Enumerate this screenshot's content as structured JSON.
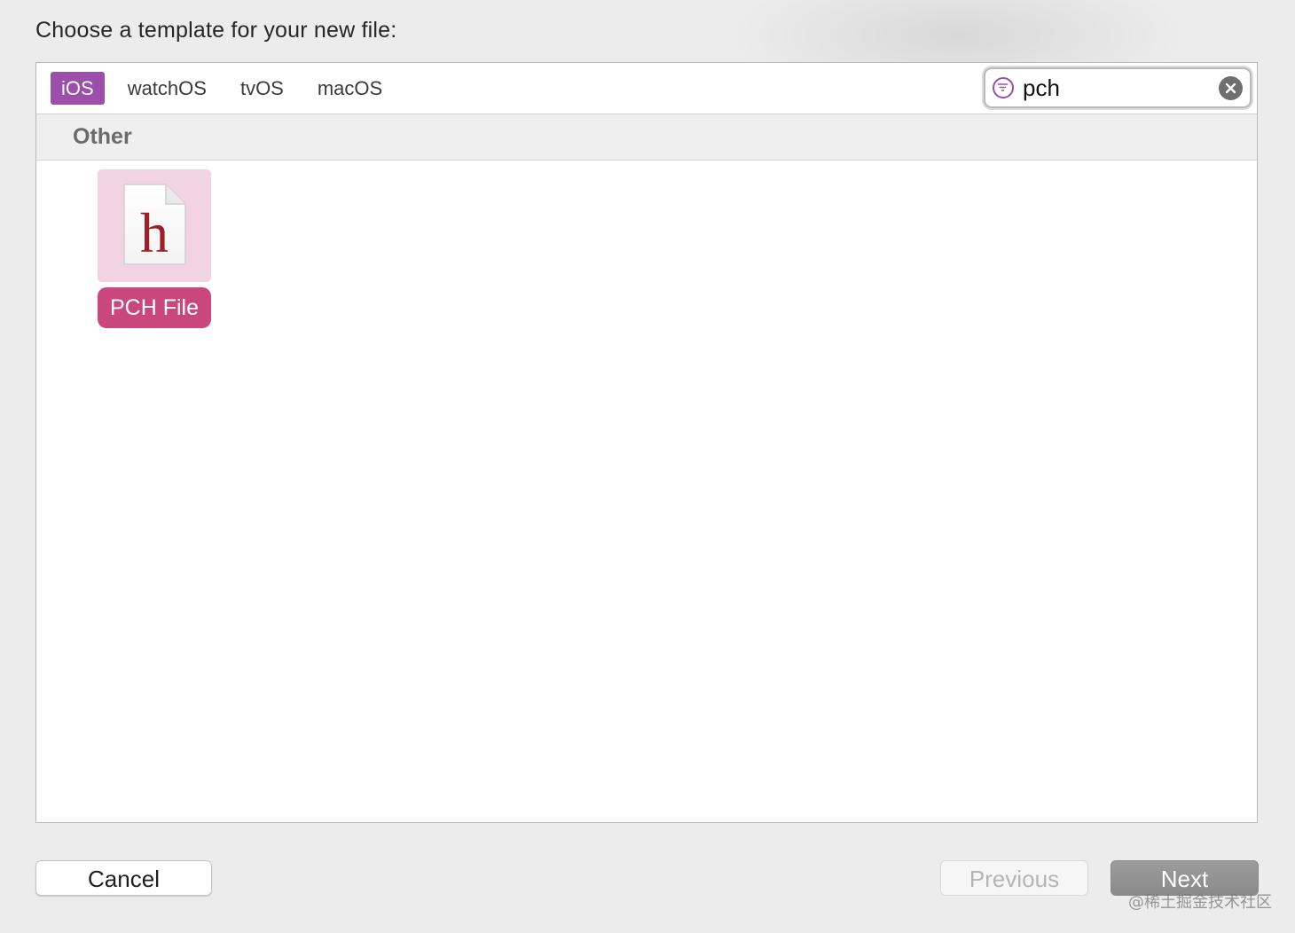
{
  "dialog": {
    "title": "Choose a template for your new file:"
  },
  "platform_tabs": [
    {
      "label": "iOS",
      "selected": true
    },
    {
      "label": "watchOS",
      "selected": false
    },
    {
      "label": "tvOS",
      "selected": false
    },
    {
      "label": "macOS",
      "selected": false
    }
  ],
  "search": {
    "value": "pch",
    "icon": "filter-icon",
    "clear_icon": "clear-icon"
  },
  "section": {
    "title": "Other"
  },
  "templates": [
    {
      "label": "PCH File",
      "icon": "header-file-icon",
      "icon_glyph": "h",
      "selected": true
    }
  ],
  "buttons": {
    "cancel": "Cancel",
    "previous": "Previous",
    "next": "Next"
  },
  "watermark": "@稀土掘金技术社区",
  "colors": {
    "accent": "#9b4fab",
    "template_selected": "#c9477c",
    "template_icon_bg": "#f2d3e1",
    "header_glyph": "#9c1f2a"
  }
}
